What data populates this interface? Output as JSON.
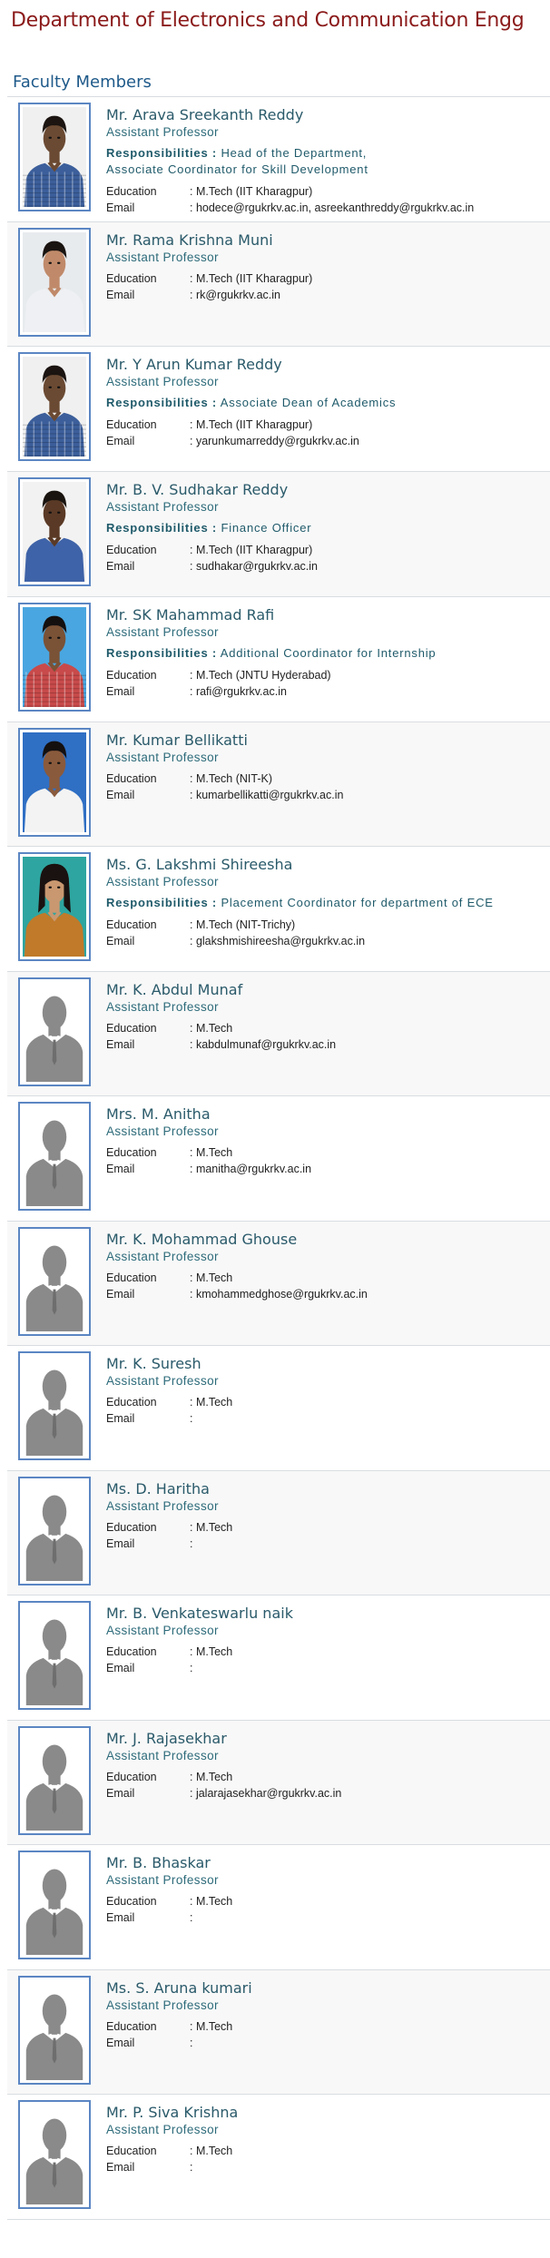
{
  "page": {
    "title": "Department of Electronics and Communication Engg",
    "section_title": "Faculty Members",
    "education_label": "Education",
    "email_label": "Email",
    "responsibilities_label": "Responsibilities :"
  },
  "colors": {
    "title": "#8b1a1a",
    "section": "#1f5a8a",
    "name": "#2a5a6a",
    "photo_border": "#5b86c3"
  },
  "members": [
    {
      "name": "Mr. Arava Sreekanth Reddy",
      "designation": "Assistant Professor",
      "responsibilities": "Head of the Department, Associate Coordinator for Skill Development",
      "education": ": M.Tech (IIT Kharagpur)",
      "email": ": hodece@rgukrkv.ac.in, asreekanthreddy@rgukrkv.ac.in",
      "photo": "photo-man-blue-check-shirt"
    },
    {
      "name": "Mr. Rama Krishna Muni",
      "designation": "Assistant Professor",
      "responsibilities": "",
      "education": ": M.Tech (IIT Kharagpur)",
      "email": ": rk@rgukrkv.ac.in",
      "photo": "photo-man-white-shirt"
    },
    {
      "name": "Mr. Y Arun Kumar Reddy",
      "designation": "Assistant Professor",
      "responsibilities": "Associate Dean of Academics",
      "education": ": M.Tech (IIT Kharagpur)",
      "email": ": yarunkumarreddy@rgukrkv.ac.in",
      "photo": "photo-man-blue-check-shirt"
    },
    {
      "name": "Mr. B. V. Sudhakar Reddy",
      "designation": "Assistant Professor",
      "responsibilities": "Finance Officer",
      "education": ": M.Tech (IIT Kharagpur)",
      "email": ": sudhakar@rgukrkv.ac.in",
      "photo": "photo-man-blue-shirt"
    },
    {
      "name": "Mr. SK Mahammad Rafi",
      "designation": "Assistant Professor",
      "responsibilities": "Additional Coordinator for Internship",
      "education": ": M.Tech (JNTU Hyderabad)",
      "email": ": rafi@rgukrkv.ac.in",
      "photo": "photo-man-check-shirt-blue-bg"
    },
    {
      "name": "Mr. Kumar Bellikatti",
      "designation": "Assistant Professor",
      "responsibilities": "",
      "education": ": M.Tech (NIT-K)",
      "email": ": kumarbellikatti@rgukrkv.ac.in",
      "photo": "photo-man-white-shirt-blue-bg"
    },
    {
      "name": "Ms. G. Lakshmi Shireesha",
      "designation": "Assistant Professor",
      "responsibilities": "Placement Coordinator for department of ECE",
      "education": ": M.Tech (NIT-Trichy)",
      "email": ": glakshmishireesha@rgukrkv.ac.in",
      "photo": "photo-woman-teal-bg"
    },
    {
      "name": "Mr. K. Abdul Munaf",
      "designation": "Assistant Professor",
      "responsibilities": "",
      "education": ": M.Tech",
      "email": ": kabdulmunaf@rgukrkv.ac.in",
      "photo": "placeholder-silhouette"
    },
    {
      "name": "Mrs. M. Anitha",
      "designation": "Assistant Professor",
      "responsibilities": "",
      "education": ": M.Tech",
      "email": ": manitha@rgukrkv.ac.in",
      "photo": "placeholder-silhouette"
    },
    {
      "name": "Mr. K. Mohammad Ghouse",
      "designation": "Assistant Professor",
      "responsibilities": "",
      "education": ": M.Tech",
      "email": ": kmohammedghose@rgukrkv.ac.in",
      "photo": "placeholder-silhouette"
    },
    {
      "name": "Mr. K. Suresh",
      "designation": "Assistant Professor",
      "responsibilities": "",
      "education": ": M.Tech",
      "email": ":",
      "photo": "placeholder-silhouette"
    },
    {
      "name": "Ms. D. Haritha",
      "designation": "Assistant Professor",
      "responsibilities": "",
      "education": ": M.Tech",
      "email": ":",
      "photo": "placeholder-silhouette"
    },
    {
      "name": "Mr. B. Venkateswarlu naik",
      "designation": "Assistant Professor",
      "responsibilities": "",
      "education": ": M.Tech",
      "email": ":",
      "photo": "placeholder-silhouette"
    },
    {
      "name": "Mr. J. Rajasekhar",
      "designation": "Assistant Professor",
      "responsibilities": "",
      "education": ": M.Tech",
      "email": ": jalarajasekhar@rgukrkv.ac.in",
      "photo": "placeholder-silhouette"
    },
    {
      "name": "Mr. B. Bhaskar",
      "designation": "Assistant Professor",
      "responsibilities": "",
      "education": ": M.Tech",
      "email": ":",
      "photo": "placeholder-silhouette"
    },
    {
      "name": "Ms. S. Aruna kumari",
      "designation": "Assistant Professor",
      "responsibilities": "",
      "education": ": M.Tech",
      "email": ":",
      "photo": "placeholder-silhouette"
    },
    {
      "name": "Mr. P. Siva Krishna",
      "designation": "Assistant Professor",
      "responsibilities": "",
      "education": ": M.Tech",
      "email": ":",
      "photo": "placeholder-silhouette"
    }
  ]
}
